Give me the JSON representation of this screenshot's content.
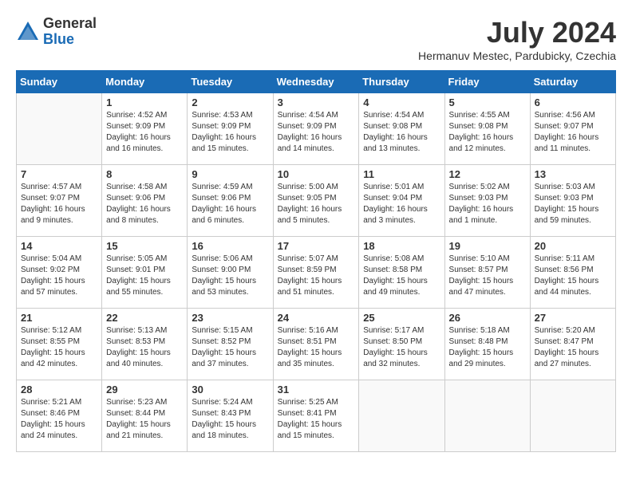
{
  "header": {
    "logo_general": "General",
    "logo_blue": "Blue",
    "month_title": "July 2024",
    "location": "Hermanuv Mestec, Pardubicky, Czechia"
  },
  "weekdays": [
    "Sunday",
    "Monday",
    "Tuesday",
    "Wednesday",
    "Thursday",
    "Friday",
    "Saturday"
  ],
  "weeks": [
    [
      {
        "day": "",
        "info": ""
      },
      {
        "day": "1",
        "info": "Sunrise: 4:52 AM\nSunset: 9:09 PM\nDaylight: 16 hours\nand 16 minutes."
      },
      {
        "day": "2",
        "info": "Sunrise: 4:53 AM\nSunset: 9:09 PM\nDaylight: 16 hours\nand 15 minutes."
      },
      {
        "day": "3",
        "info": "Sunrise: 4:54 AM\nSunset: 9:09 PM\nDaylight: 16 hours\nand 14 minutes."
      },
      {
        "day": "4",
        "info": "Sunrise: 4:54 AM\nSunset: 9:08 PM\nDaylight: 16 hours\nand 13 minutes."
      },
      {
        "day": "5",
        "info": "Sunrise: 4:55 AM\nSunset: 9:08 PM\nDaylight: 16 hours\nand 12 minutes."
      },
      {
        "day": "6",
        "info": "Sunrise: 4:56 AM\nSunset: 9:07 PM\nDaylight: 16 hours\nand 11 minutes."
      }
    ],
    [
      {
        "day": "7",
        "info": "Sunrise: 4:57 AM\nSunset: 9:07 PM\nDaylight: 16 hours\nand 9 minutes."
      },
      {
        "day": "8",
        "info": "Sunrise: 4:58 AM\nSunset: 9:06 PM\nDaylight: 16 hours\nand 8 minutes."
      },
      {
        "day": "9",
        "info": "Sunrise: 4:59 AM\nSunset: 9:06 PM\nDaylight: 16 hours\nand 6 minutes."
      },
      {
        "day": "10",
        "info": "Sunrise: 5:00 AM\nSunset: 9:05 PM\nDaylight: 16 hours\nand 5 minutes."
      },
      {
        "day": "11",
        "info": "Sunrise: 5:01 AM\nSunset: 9:04 PM\nDaylight: 16 hours\nand 3 minutes."
      },
      {
        "day": "12",
        "info": "Sunrise: 5:02 AM\nSunset: 9:03 PM\nDaylight: 16 hours\nand 1 minute."
      },
      {
        "day": "13",
        "info": "Sunrise: 5:03 AM\nSunset: 9:03 PM\nDaylight: 15 hours\nand 59 minutes."
      }
    ],
    [
      {
        "day": "14",
        "info": "Sunrise: 5:04 AM\nSunset: 9:02 PM\nDaylight: 15 hours\nand 57 minutes."
      },
      {
        "day": "15",
        "info": "Sunrise: 5:05 AM\nSunset: 9:01 PM\nDaylight: 15 hours\nand 55 minutes."
      },
      {
        "day": "16",
        "info": "Sunrise: 5:06 AM\nSunset: 9:00 PM\nDaylight: 15 hours\nand 53 minutes."
      },
      {
        "day": "17",
        "info": "Sunrise: 5:07 AM\nSunset: 8:59 PM\nDaylight: 15 hours\nand 51 minutes."
      },
      {
        "day": "18",
        "info": "Sunrise: 5:08 AM\nSunset: 8:58 PM\nDaylight: 15 hours\nand 49 minutes."
      },
      {
        "day": "19",
        "info": "Sunrise: 5:10 AM\nSunset: 8:57 PM\nDaylight: 15 hours\nand 47 minutes."
      },
      {
        "day": "20",
        "info": "Sunrise: 5:11 AM\nSunset: 8:56 PM\nDaylight: 15 hours\nand 44 minutes."
      }
    ],
    [
      {
        "day": "21",
        "info": "Sunrise: 5:12 AM\nSunset: 8:55 PM\nDaylight: 15 hours\nand 42 minutes."
      },
      {
        "day": "22",
        "info": "Sunrise: 5:13 AM\nSunset: 8:53 PM\nDaylight: 15 hours\nand 40 minutes."
      },
      {
        "day": "23",
        "info": "Sunrise: 5:15 AM\nSunset: 8:52 PM\nDaylight: 15 hours\nand 37 minutes."
      },
      {
        "day": "24",
        "info": "Sunrise: 5:16 AM\nSunset: 8:51 PM\nDaylight: 15 hours\nand 35 minutes."
      },
      {
        "day": "25",
        "info": "Sunrise: 5:17 AM\nSunset: 8:50 PM\nDaylight: 15 hours\nand 32 minutes."
      },
      {
        "day": "26",
        "info": "Sunrise: 5:18 AM\nSunset: 8:48 PM\nDaylight: 15 hours\nand 29 minutes."
      },
      {
        "day": "27",
        "info": "Sunrise: 5:20 AM\nSunset: 8:47 PM\nDaylight: 15 hours\nand 27 minutes."
      }
    ],
    [
      {
        "day": "28",
        "info": "Sunrise: 5:21 AM\nSunset: 8:46 PM\nDaylight: 15 hours\nand 24 minutes."
      },
      {
        "day": "29",
        "info": "Sunrise: 5:23 AM\nSunset: 8:44 PM\nDaylight: 15 hours\nand 21 minutes."
      },
      {
        "day": "30",
        "info": "Sunrise: 5:24 AM\nSunset: 8:43 PM\nDaylight: 15 hours\nand 18 minutes."
      },
      {
        "day": "31",
        "info": "Sunrise: 5:25 AM\nSunset: 8:41 PM\nDaylight: 15 hours\nand 15 minutes."
      },
      {
        "day": "",
        "info": ""
      },
      {
        "day": "",
        "info": ""
      },
      {
        "day": "",
        "info": ""
      }
    ]
  ]
}
